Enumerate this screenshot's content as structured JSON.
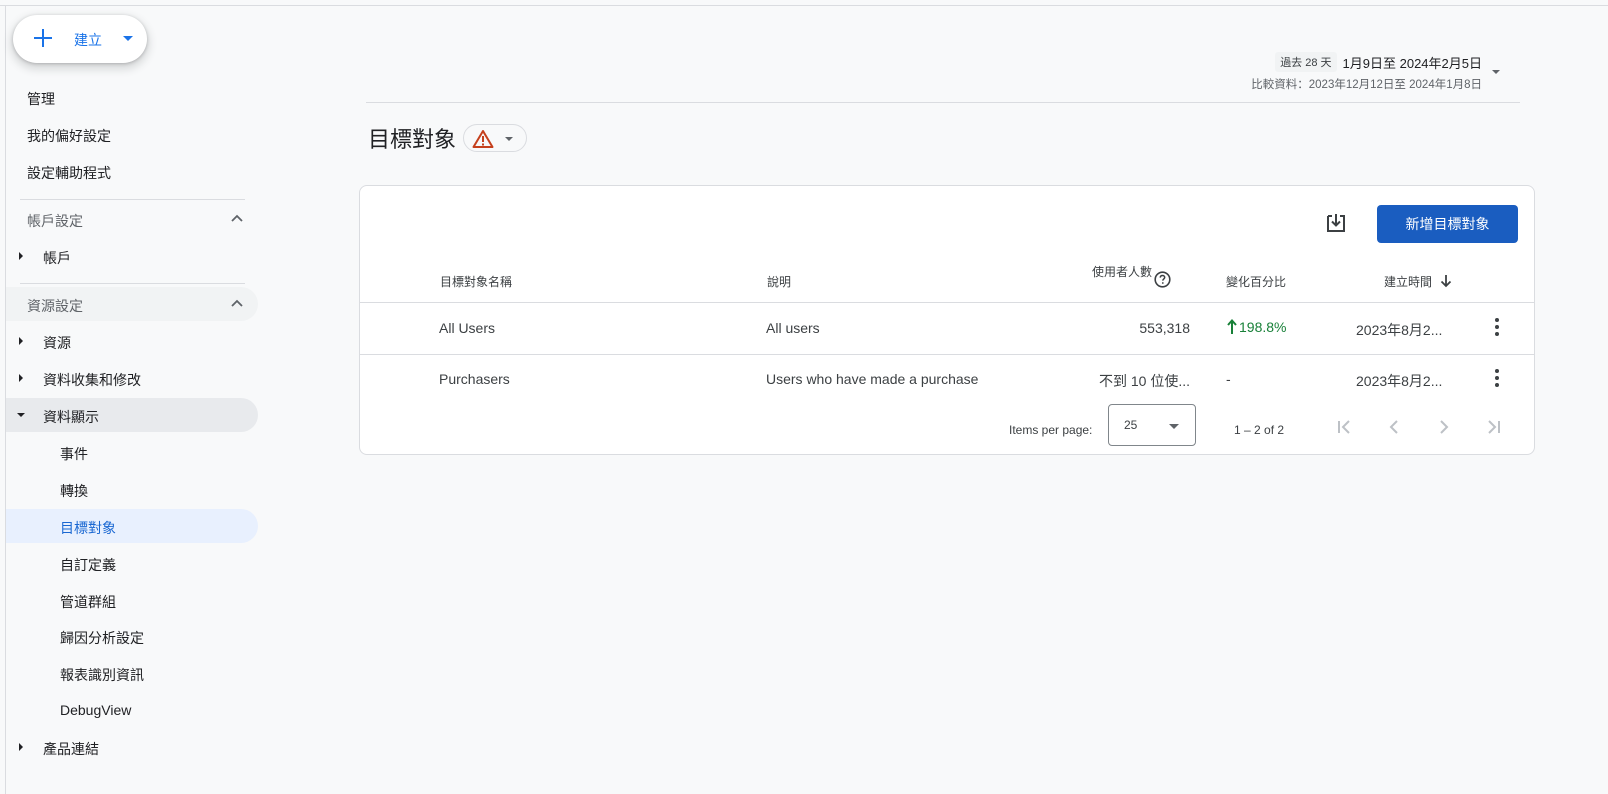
{
  "create_button": {
    "label": "建立"
  },
  "sidebar": {
    "top_items": [
      "管理",
      "我的偏好設定",
      "設定輔助程式"
    ],
    "account_section": {
      "label": "帳戶設定",
      "items": [
        "帳戶"
      ]
    },
    "property_section": {
      "label": "資源設定",
      "items": [
        "資源",
        "資料收集和修改",
        "資料顯示"
      ],
      "data_display_children": [
        "事件",
        "轉換",
        "目標對象",
        "自訂定義",
        "管道群組",
        "歸因分析設定",
        "報表識別資訊",
        "DebugView"
      ],
      "active_item": "目標對象"
    },
    "bottom_item": "產品連結"
  },
  "date_range": {
    "chip": "過去 28 天",
    "range": "1月9日至 2024年2月5日",
    "compare": "比較資料：2023年12月12日至 2024年1月8日"
  },
  "page": {
    "title": "目標對象"
  },
  "toolbar": {
    "new_button": "新增目標對象"
  },
  "table": {
    "headers": {
      "name": "目標對象名稱",
      "description": "說明",
      "users": "使用者人數",
      "change": "變化百分比",
      "created": "建立時間"
    },
    "rows": [
      {
        "name": "All Users",
        "description": "All users",
        "users": "553,318",
        "change": "198.8%",
        "change_direction": "up",
        "created": "2023年8月2..."
      },
      {
        "name": "Purchasers",
        "description": "Users who have made a purchase",
        "users": "不到 10 位使...",
        "change": "-",
        "change_direction": "none",
        "created": "2023年8月2..."
      }
    ]
  },
  "pagination": {
    "items_per_page_label": "Items per page:",
    "items_per_page": "25",
    "range": "1 – 2 of 2"
  },
  "colors": {
    "accent": "#1a73e8",
    "primary_button": "#1a5dc0",
    "positive": "#188038",
    "warning": "#c5401d",
    "active_nav_bg": "#e8f0fe"
  },
  "icons": [
    "plus-icon",
    "chevron-up-icon",
    "warning-icon",
    "download-icon",
    "help-icon",
    "arrow-down-icon",
    "arrow-up-icon",
    "more-vert-icon",
    "first-page-icon",
    "prev-page-icon",
    "next-page-icon",
    "last-page-icon"
  ]
}
